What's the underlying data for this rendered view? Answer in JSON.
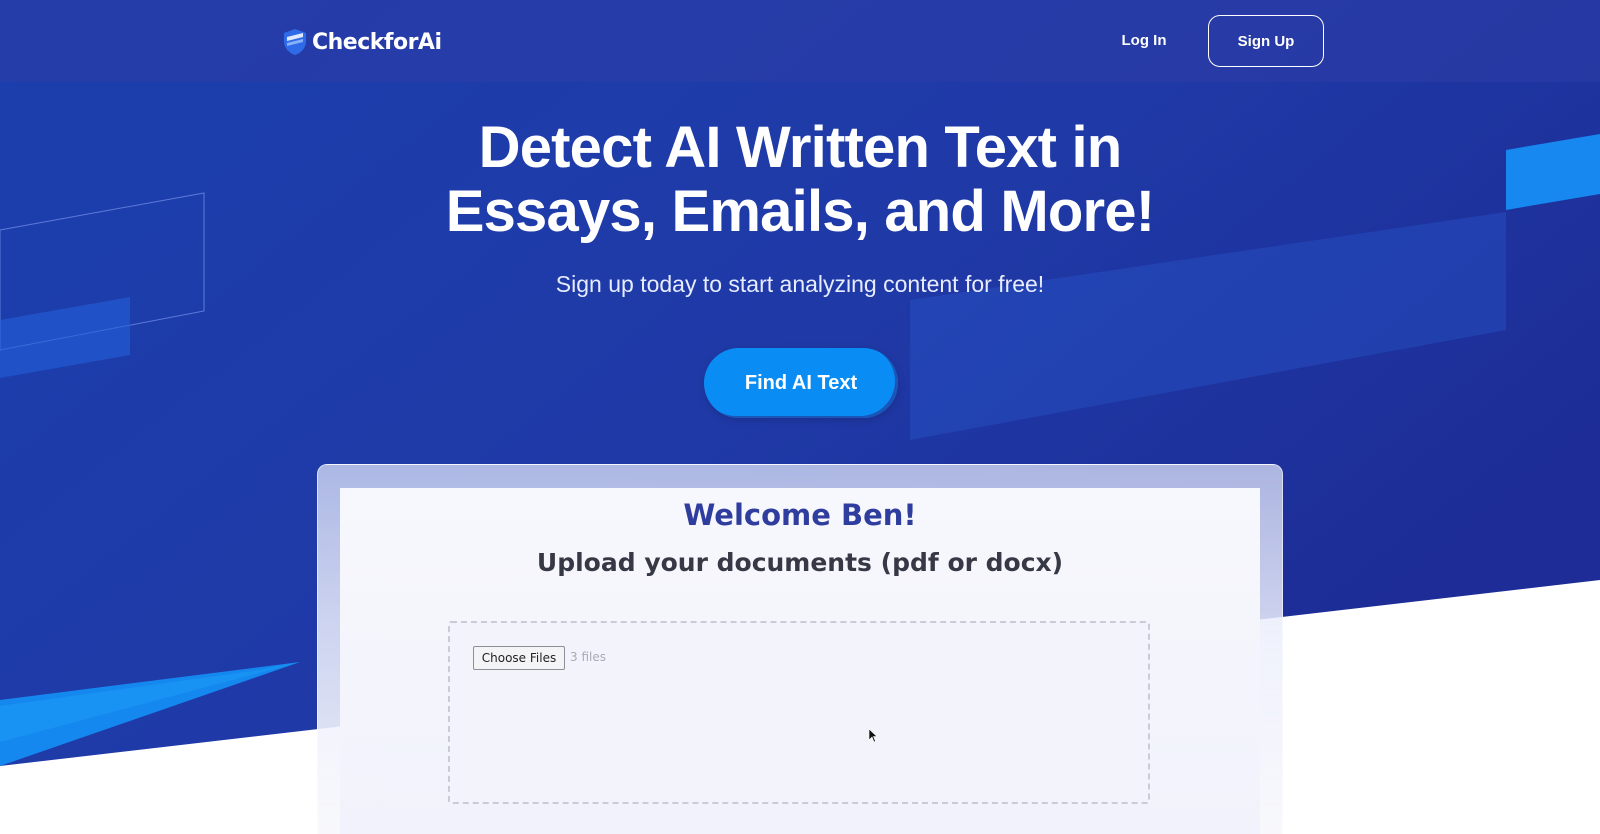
{
  "colors": {
    "hero_blue": "#1e3aa8",
    "accent_blue": "#0a8cf5",
    "welcome_text": "#2f3d9e"
  },
  "header": {
    "brand": "CheckforAi",
    "logo_icon": "shield-check-icon",
    "login_label": "Log In",
    "signup_label": "Sign Up"
  },
  "hero": {
    "title_line1": "Detect AI Written Text in",
    "title_line2": "Essays, Emails, and More!",
    "subtitle": "Sign up today to start analyzing content for free!",
    "cta_label": "Find AI Text"
  },
  "preview": {
    "welcome": "Welcome Ben!",
    "upload_title": "Upload your documents (pdf or docx)",
    "choose_files_label": "Choose Files",
    "file_count": "3 files"
  }
}
